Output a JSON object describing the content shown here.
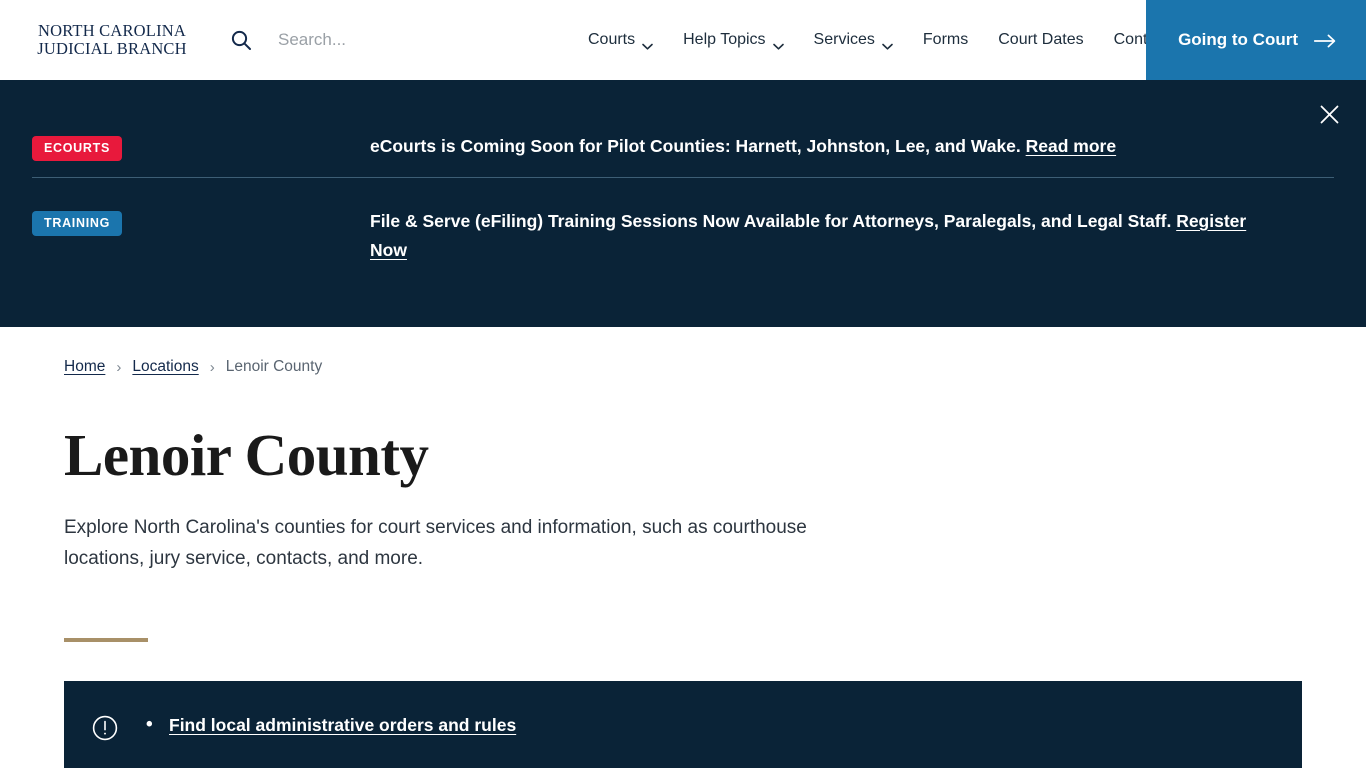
{
  "header": {
    "logo_line1": "NORTH CAROLINA",
    "logo_line2": "JUDICIAL BRANCH",
    "search": {
      "placeholder": "Search...",
      "value": "",
      "icon": "search-icon"
    },
    "nav": [
      {
        "label": "Courts",
        "has_dropdown": true
      },
      {
        "label": "Help Topics",
        "has_dropdown": true
      },
      {
        "label": "Services",
        "has_dropdown": true
      },
      {
        "label": "Forms",
        "has_dropdown": false
      },
      {
        "label": "Court Dates",
        "has_dropdown": false
      },
      {
        "label": "Contact",
        "has_dropdown": false
      }
    ],
    "cta": {
      "label": "Going to Court",
      "icon": "arrow-right-icon",
      "background": "#1b75ad"
    }
  },
  "alert_band": {
    "background": "#0a2337",
    "close_icon": "close-icon",
    "alerts": [
      {
        "badge": "ECOURTS",
        "badge_color": "#e8193c",
        "text": "eCourts is Coming Soon for Pilot Counties: Harnett, Johnston, Lee, and Wake. ",
        "link_text": "Read more"
      },
      {
        "badge": "TRAINING",
        "badge_color": "#1b75ad",
        "text": "File & Serve (eFiling) Training Sessions Now Available for Attorneys, Paralegals, and Legal Staff. ",
        "link_text": "Register Now"
      }
    ]
  },
  "main": {
    "breadcrumb": {
      "items": [
        {
          "label": "Home",
          "is_link": true
        },
        {
          "label": "Locations",
          "is_link": true
        },
        {
          "label": "Lenoir County",
          "is_link": false
        }
      ],
      "separator": "›"
    },
    "page_title": "Lenoir County",
    "intro": "Explore North Carolina's counties for court services and information, such as courthouse locations, jury service, contacts, and more.",
    "gold_rule_color": "#a89068",
    "notice": {
      "icon": "alert-circle-icon",
      "background": "#0a2337",
      "items": [
        {
          "label": "Find local administrative orders and rules"
        }
      ]
    }
  }
}
